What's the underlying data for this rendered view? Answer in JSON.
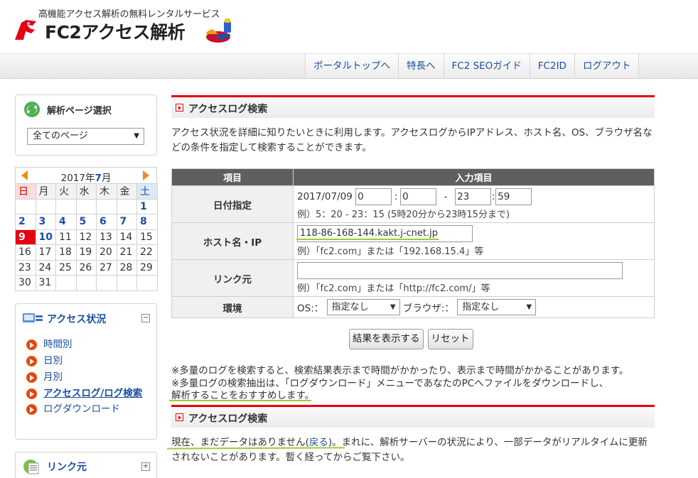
{
  "header": {
    "tagline": "高機能アクセス解析の無料レンタルサービス",
    "logo_text": "FC2アクセス解析"
  },
  "nav": {
    "items": [
      "ポータルトップへ",
      "特長へ",
      "FC2 SEOガイド",
      "FC2ID",
      "ログアウト"
    ]
  },
  "sidebar": {
    "page_select": {
      "title": "解析ページ選択",
      "selected": "全てのページ"
    },
    "calendar": {
      "year_label": "2017年",
      "month": "7",
      "month_suffix": "月",
      "weekdays": [
        "日",
        "月",
        "火",
        "水",
        "木",
        "金",
        "土"
      ],
      "weeks": [
        [
          "",
          "",
          "",
          "",
          "",
          "",
          "1"
        ],
        [
          "2",
          "3",
          "4",
          "5",
          "6",
          "7",
          "8"
        ],
        [
          "9",
          "10",
          "11",
          "12",
          "13",
          "14",
          "15"
        ],
        [
          "16",
          "17",
          "18",
          "19",
          "20",
          "21",
          "22"
        ],
        [
          "23",
          "24",
          "25",
          "26",
          "27",
          "28",
          "29"
        ],
        [
          "30",
          "31",
          "",
          "",
          "",
          "",
          ""
        ]
      ],
      "today": "9"
    },
    "access_status": {
      "title": "アクセス状況",
      "toggle": "−",
      "items": [
        "時間別",
        "日別",
        "月別",
        "アクセスログ/ログ検索",
        "ログダウンロード"
      ]
    },
    "referrer": {
      "title": "リンク元",
      "toggle": "+"
    }
  },
  "main": {
    "section1_title": "アクセスログ検索",
    "intro": "アクセス状況を詳細に知りたいときに利用します。アクセスログからIPアドレス、ホスト名、OS、ブラウザ名などの条件を指定して検索することができます。",
    "table": {
      "head_item": "項目",
      "head_input": "入力項目",
      "date_label": "日付指定",
      "date_value": "2017/07/09",
      "start_hour": "0",
      "start_min": "0",
      "end_hour": "23",
      "end_min": "59",
      "date_example": "例）5：20 - 23：15 (5時20分から23時15分まで)",
      "host_label": "ホスト名・IP",
      "host_value": "118-86-168-144.kakt.j-cnet.jp",
      "host_example": "例）「fc2.com」または「192.168.15.4」等",
      "ref_label": "リンク元",
      "ref_value": "",
      "ref_example": "例）「fc2.com」または「http://fc2.com/」等",
      "env_label": "環境",
      "os_label": "OS:：",
      "os_value": "指定なし",
      "browser_label": "ブラウザ:：",
      "browser_value": "指定なし"
    },
    "buttons": {
      "show": "結果を表示する",
      "reset": "リセット"
    },
    "notes": [
      "※多量のログを検索すると、検索結果表示まで時間がかかったり、表示まで時間がかかることがあります。",
      "※多量ログの検索抽出は、「ログダウンロード」メニューであなたのPCへファイルをダウンロードし、",
      "解析することをおすすめします。"
    ],
    "section2_title": "アクセスログ検索",
    "result_pre": "現在、まだデータはありません(",
    "result_back": "戻る",
    "result_post": ")。まれに、解析サーバーの状況により、一部データがリアルタイムに更新されないことがあります。暫く経ってからご覧下さい。"
  }
}
